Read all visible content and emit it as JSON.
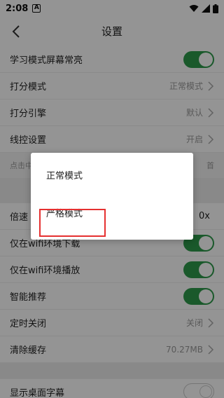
{
  "status_bar": {
    "time": "2:08",
    "notif_glyph": "A"
  },
  "header": {
    "title": "设置"
  },
  "rows": [
    {
      "label": "学习模式屏幕常亮",
      "type": "toggle",
      "on": true
    },
    {
      "label": "打分模式",
      "value": "正常模式",
      "type": "select"
    },
    {
      "label": "打分引擎",
      "value": "默认",
      "type": "select"
    },
    {
      "label": "线控设置",
      "value": "开启",
      "type": "select"
    },
    {
      "label": "倍速",
      "value": "0x",
      "type": "select"
    },
    {
      "label": "仅在wifi环境下载",
      "type": "toggle",
      "on": true
    },
    {
      "label": "仅在wifi环境播放",
      "type": "toggle",
      "on": true
    },
    {
      "label": "智能推荐",
      "type": "toggle",
      "on": true
    },
    {
      "label": "定时关闭",
      "value": "关闭",
      "type": "select"
    },
    {
      "label": "清除缓存",
      "value": "70.27MB",
      "type": "select"
    },
    {
      "label": "显示桌面字幕",
      "type": "toggle",
      "on": false
    }
  ],
  "hint": {
    "left": "点击中",
    "right": "首"
  },
  "dialog": {
    "options": [
      "正常模式",
      "严格模式"
    ],
    "highlighted_index": 1
  },
  "colors": {
    "toggle_on": "#2e9a4a",
    "highlight": "#e53030"
  }
}
